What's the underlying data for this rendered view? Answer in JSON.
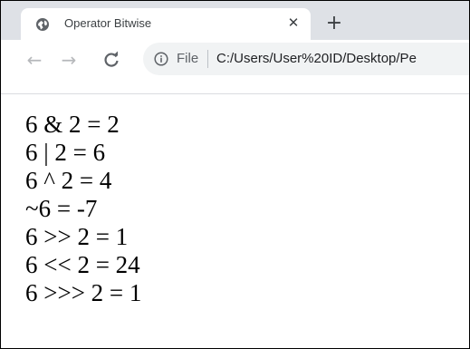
{
  "tab": {
    "title": "Operator Bitwise",
    "close_glyph": "✕",
    "new_tab_glyph": "+"
  },
  "toolbar": {
    "back_glyph": "←",
    "forward_glyph": "→",
    "reload_glyph": "C",
    "scheme_label": "File",
    "url": "C:/Users/User%20ID/Desktop/Pe"
  },
  "icons": {
    "favicon": "globe-icon",
    "site_info": "info-icon"
  },
  "colors": {
    "tabstrip_bg": "#dee1e6",
    "omnibox_bg": "#f1f3f4"
  },
  "page": {
    "lines": [
      "6 & 2 = 2",
      "6 | 2 = 6",
      "6 ^ 2 = 4",
      "~6 = -7",
      "6 >> 2 = 1",
      "6 << 2 = 24",
      "6 >>> 2 = 1"
    ]
  }
}
